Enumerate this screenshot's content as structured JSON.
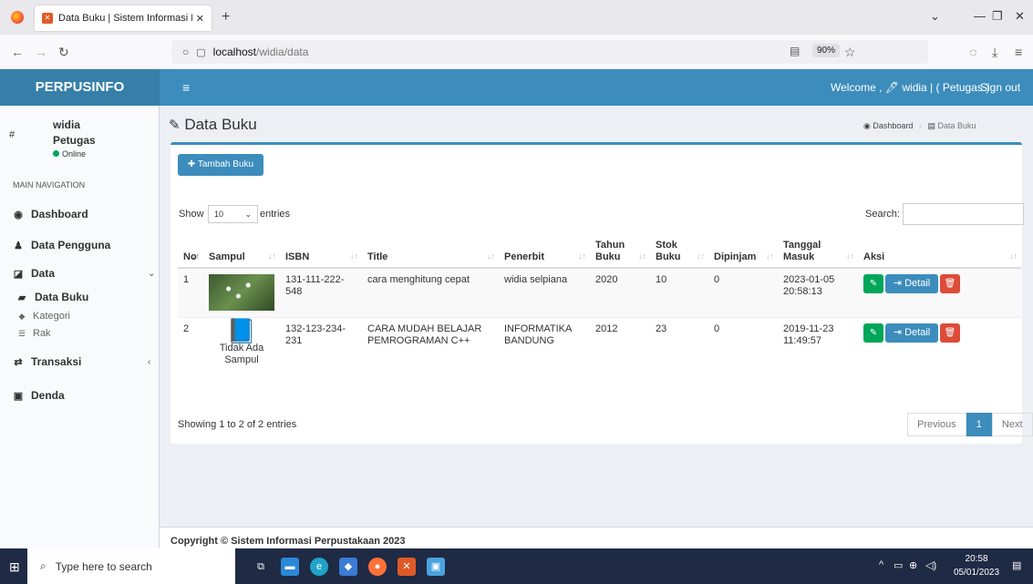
{
  "browser": {
    "tab_title": "Data Buku | Sistem Informasi Pe",
    "url_host": "localhost",
    "url_path": "/widia/data",
    "zoom": "90%"
  },
  "header": {
    "brand": "PERPUSINFO",
    "welcome": "Welcome , 🖊 widia | ( Petugas )",
    "sign_out": "Sign out"
  },
  "sidebar": {
    "user_hash": "#",
    "user_name": "widia",
    "user_role": "Petugas",
    "status": "Online",
    "nav_label": "MAIN NAVIGATION",
    "items": {
      "dashboard": "Dashboard",
      "pengguna": "Data Pengguna",
      "data": "Data",
      "data_buku": "Data Buku",
      "kategori": "Kategori",
      "rak": "Rak",
      "transaksi": "Transaksi",
      "denda": "Denda"
    }
  },
  "page": {
    "title": "Data Buku",
    "breadcrumb_home": "Dashboard",
    "breadcrumb_current": "Data Buku",
    "add_button": "Tambah Buku",
    "show_label": "Show",
    "show_value": "10",
    "entries_label": "entries",
    "search_label": "Search:",
    "search_value": "",
    "showing_info": "Showing 1 to 2 of 2 entries",
    "pager_prev": "Previous",
    "pager_current": "1",
    "pager_next": "Next",
    "footer": "Copyright © Sistem Informasi Perpustakaan 2023"
  },
  "table": {
    "headers": {
      "no": "No",
      "sampul": "Sampul",
      "isbn": "ISBN",
      "title": "Title",
      "penerbit": "Penerbit",
      "tahun_1": "Tahun",
      "tahun_2": "Buku",
      "stok_1": "Stok",
      "stok_2": "Buku",
      "dipinjam": "Dipinjam",
      "tanggal_1": "Tanggal",
      "tanggal_2": "Masuk",
      "aksi": "Aksi"
    },
    "rows": [
      {
        "no": "1",
        "isbn": "131-111-222-548",
        "title": "cara menghitung cepat",
        "penerbit": "widia selpiana",
        "tahun": "2020",
        "stok": "10",
        "dipinjam": "0",
        "tanggal_1": "2023-01-05",
        "tanggal_2": "20:58:13"
      },
      {
        "no": "2",
        "isbn": "132-123-234-231",
        "title_1": "CARA MUDAH BELAJAR",
        "title_2": "PEMROGRAMAN C++",
        "penerbit_1": "INFORMATIKA",
        "penerbit_2": "BANDUNG",
        "tahun": "2012",
        "stok": "23",
        "dipinjam": "0",
        "tanggal_1": "2019-11-23",
        "tanggal_2": "11:49:57",
        "no_cover_1": "Tidak Ada",
        "no_cover_2": "Sampul"
      }
    ],
    "detail_label": "Detail"
  },
  "taskbar": {
    "search_placeholder": "Type here to search",
    "time": "20:58",
    "date": "05/01/2023"
  }
}
